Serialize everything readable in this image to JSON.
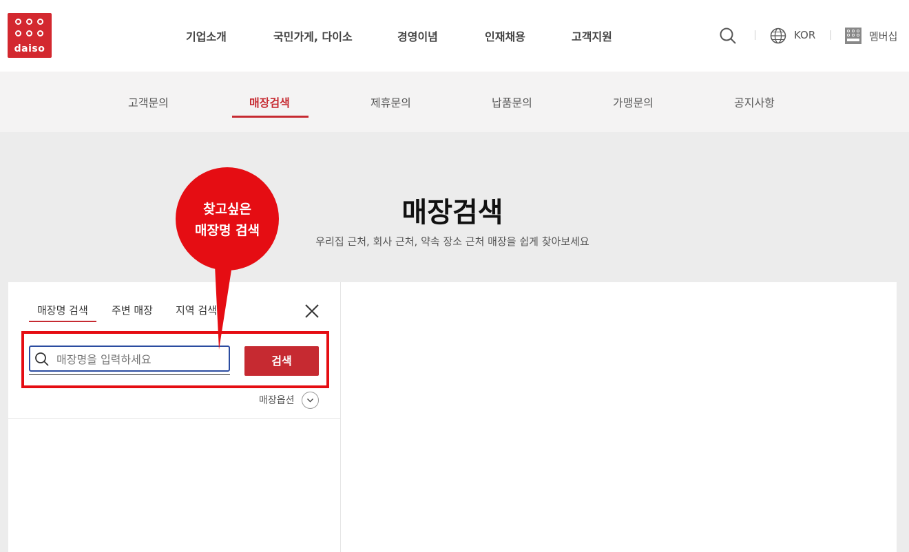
{
  "logo": {
    "text": "daiso"
  },
  "nav": {
    "items": [
      "기업소개",
      "국민가게, 다이소",
      "경영이념",
      "인재채용",
      "고객지원"
    ]
  },
  "utility": {
    "lang_label": "KOR",
    "membership_label": "멤버십"
  },
  "subnav": {
    "items": [
      "고객문의",
      "매장검색",
      "제휴문의",
      "납품문의",
      "가맹문의",
      "공지사항"
    ],
    "active": "매장검색"
  },
  "hero": {
    "title": "매장검색",
    "subtitle": "우리집 근처, 회사 근처, 약속 장소 근처 매장을 쉽게 찾아보세요"
  },
  "search_panel": {
    "tabs": [
      "매장명 검색",
      "주변 매장",
      "지역 검색"
    ],
    "active_tab": "매장명 검색",
    "input_value": "",
    "input_placeholder": "매장명을 입력하세요",
    "search_button": "검색",
    "options_label": "매장옵션"
  },
  "annotation": {
    "line1": "찾고싶은",
    "line2": "매장명 검색"
  },
  "colors": {
    "brand_red": "#d3282f",
    "accent_red": "#c62a31",
    "annotation_red": "#e50d13",
    "input_border": "#2b4ca0"
  }
}
